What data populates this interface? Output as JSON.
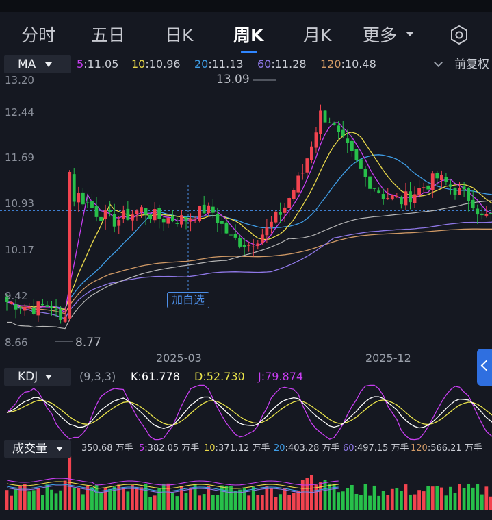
{
  "tabs": [
    {
      "label": "分时"
    },
    {
      "label": "五日"
    },
    {
      "label": "日K"
    },
    {
      "label": "周K"
    },
    {
      "label": "月K"
    },
    {
      "label": "更多"
    }
  ],
  "active_tab": "周K",
  "ma_panel": {
    "button_label": "MA",
    "values": [
      {
        "period": "5",
        "value": "11.05",
        "color": "#c73ef0"
      },
      {
        "period": "10",
        "value": "10.96",
        "color": "#e9d84a"
      },
      {
        "period": "20",
        "value": "11.13",
        "color": "#3f9de6"
      },
      {
        "period": "60",
        "value": "11.28",
        "color": "#8f78e8"
      },
      {
        "period": "120",
        "value": "10.48",
        "color": "#d19a66"
      }
    ],
    "adjust_label": "前复权",
    "price_axis": [
      "13.20",
      "12.44",
      "11.69",
      "10.93",
      "10.17",
      "9.42",
      "8.66"
    ],
    "high_callout": "13.09",
    "low_callout": "8.77",
    "add_watchlist_label": "加自选",
    "date_labels": [
      "2025-03",
      "2025-12"
    ]
  },
  "kdj_panel": {
    "button_label": "KDJ",
    "params": "(9,3,3)",
    "k": "K:61.778",
    "d": "D:52.730",
    "j": "J:79.874",
    "k_color": "#ffffff",
    "d_color": "#e9e34a",
    "j_color": "#c73ef0"
  },
  "volume_panel": {
    "button_label": "成交量",
    "current": "350.68 万手",
    "mas": [
      {
        "period": "5",
        "value": "382.05 万手",
        "color": "#c73ef0"
      },
      {
        "period": "10",
        "value": "371.12 万手",
        "color": "#e9d84a"
      },
      {
        "period": "20",
        "value": "403.28 万手",
        "color": "#3f9de6"
      },
      {
        "period": "60",
        "value": "497.15 万手",
        "color": "#8f78e8"
      },
      {
        "period": "120",
        "value": "566.21 万手",
        "color": "#d19a66"
      }
    ]
  },
  "colors": {
    "up": "#f2434f",
    "down": "#27c04a",
    "ma5": "#c73ef0",
    "ma10": "#e9d84a",
    "ma20": "#3f9de6",
    "ma60": "#8f78e8",
    "ma120": "#d19a66",
    "accent": "#2f86ff"
  },
  "chart_data": {
    "type": "candlestick",
    "interval": "weekly",
    "ylim": [
      8.66,
      13.2
    ],
    "high": 13.09,
    "low": 8.77,
    "reference_price": 10.93
  }
}
